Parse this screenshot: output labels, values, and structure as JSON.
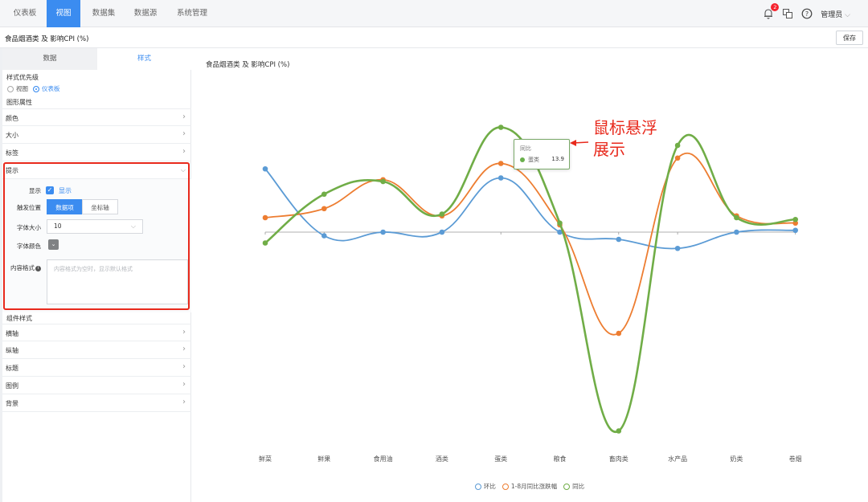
{
  "nav": {
    "items": [
      "仪表板",
      "视图",
      "数据集",
      "数据源",
      "系统管理"
    ],
    "active_index": 1,
    "badge_count": "2",
    "user": "管理员"
  },
  "titlebar": {
    "title": "食品烟酒类 及 影响CPI (%)",
    "save_label": "保存"
  },
  "panel": {
    "tabs": [
      "数据",
      "样式"
    ],
    "style_priority_label": "样式优先级",
    "radio_view": "视图",
    "radio_dashboard": "仪表板",
    "graph_props_label": "图形属性",
    "graph_rows": [
      "颜色",
      "大小",
      "标签"
    ],
    "tooltip_row": "提示",
    "tooltip": {
      "show_label": "显示",
      "show_text": "显示",
      "trigger_label": "触发位置",
      "trigger_options": [
        "数据项",
        "坐标轴"
      ],
      "font_size_label": "字体大小",
      "font_size_value": "10",
      "font_color_label": "字体颜色",
      "format_label": "内容格式",
      "format_placeholder": "内容格式为空时，显示默认格式"
    },
    "component_style_label": "组件样式",
    "component_rows": [
      "横轴",
      "纵轴",
      "标题",
      "图例",
      "背景"
    ]
  },
  "chart_data": {
    "type": "line",
    "title": "食品烟酒类 及 影响CPI (%)",
    "categories": [
      "鲜菜",
      "鲜果",
      "食用油",
      "酒类",
      "蛋类",
      "粮食",
      "畜肉类",
      "水产品",
      "奶类",
      "卷烟"
    ],
    "series": [
      {
        "name": "环比",
        "color": "#5b9bd5",
        "values": [
          3.5,
          -0.2,
          0.0,
          0.0,
          3.0,
          0.0,
          -0.4,
          -0.9,
          0.0,
          0.1
        ]
      },
      {
        "name": "1-8月同比涨跌幅",
        "color": "#ed7d31",
        "values": [
          0.8,
          1.3,
          2.9,
          0.9,
          3.8,
          0.4,
          -5.6,
          4.1,
          0.9,
          0.5
        ]
      },
      {
        "name": "同比",
        "color": "#70ad47",
        "values": [
          -0.6,
          2.1,
          2.8,
          1.0,
          5.8,
          0.5,
          -11.0,
          4.8,
          0.8,
          0.7
        ]
      }
    ],
    "smooth": true,
    "grid": false,
    "legend": "bottom"
  },
  "tooltip_popup": {
    "title": "同比",
    "name": "蛋类",
    "value": "13.9"
  },
  "annotation": [
    "鼠标悬浮",
    "展示"
  ]
}
